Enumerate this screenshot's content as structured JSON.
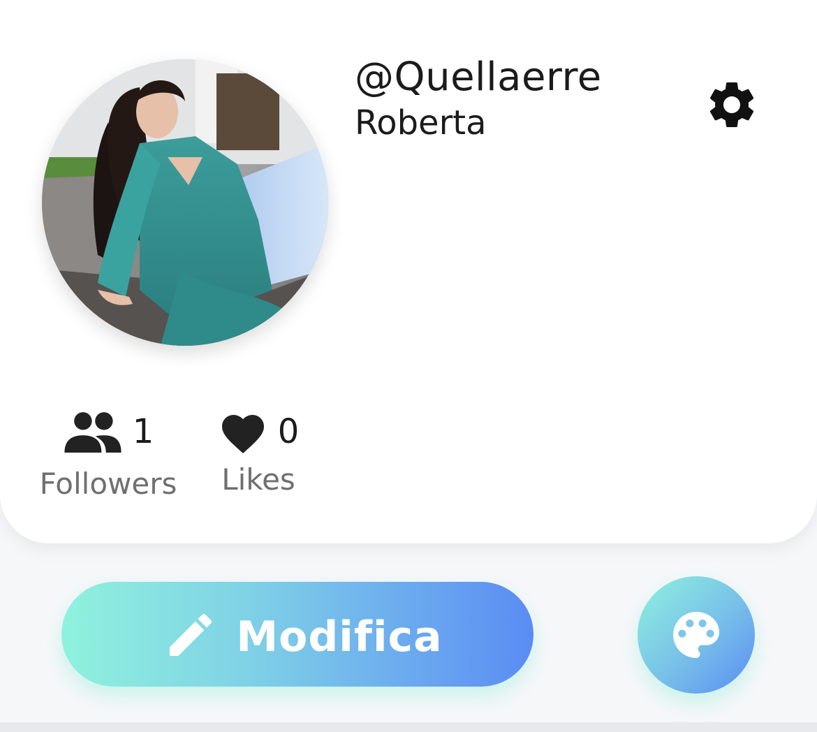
{
  "profile": {
    "username": "@Quellaerre",
    "display_name": "Roberta",
    "avatar_alt": "profile-photo"
  },
  "stats": {
    "followers": {
      "value": "1",
      "label": "Followers",
      "icon": "people-icon"
    },
    "likes": {
      "value": "0",
      "label": "Likes",
      "icon": "heart-icon"
    }
  },
  "actions": {
    "edit_label": "Modifica",
    "edit_icon": "pencil-icon",
    "theme_icon": "palette-icon",
    "settings_icon": "gear-icon"
  },
  "colors": {
    "gradient_start": "#8ff2dd",
    "gradient_end": "#5a8cf2",
    "text_primary": "#1b1b1b",
    "text_secondary": "#6f6f6f"
  }
}
